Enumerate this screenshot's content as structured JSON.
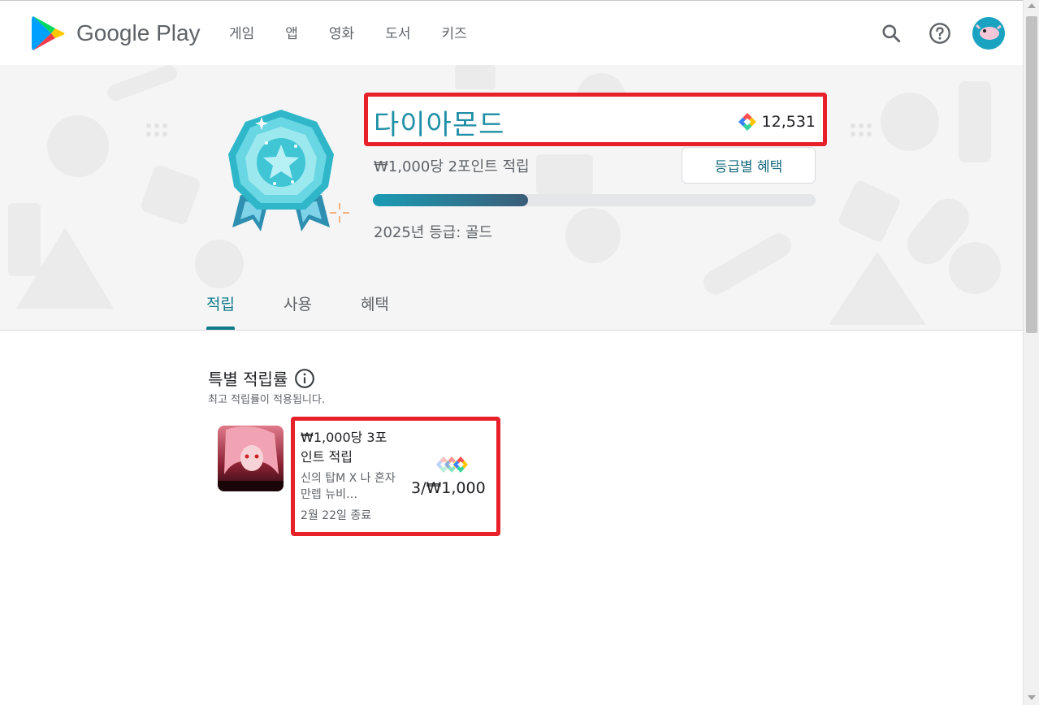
{
  "header": {
    "logo_text": "Google Play",
    "nav": [
      "게임",
      "앱",
      "영화",
      "도서",
      "키즈"
    ],
    "icons": [
      "search-icon",
      "help-icon",
      "avatar"
    ]
  },
  "hero": {
    "tier_name": "다이아몬드",
    "points": "12,531",
    "rate_text": "₩1,000당 2포인트 적립",
    "benefit_button": "등급별 혜택",
    "progress": 0.35,
    "year_tier": "2025년 등급: 골드"
  },
  "tabs": [
    {
      "label": "적립",
      "active": true
    },
    {
      "label": "사용",
      "active": false
    },
    {
      "label": "혜택",
      "active": false
    }
  ],
  "special": {
    "title": "특별 적립률",
    "subtitle": "최고 적립률이 적용됩니다.",
    "card": {
      "title": "₩1,000당 3포인트 적립",
      "game": "신의 탑M X 나 혼자 만렙 뉴비…",
      "end_date": "2월 22일 종료",
      "rate": "3/₩1,000"
    }
  },
  "colors": {
    "accent": "#107a8c",
    "tier": "#1e8fa6",
    "highlight": "#e8202a"
  }
}
